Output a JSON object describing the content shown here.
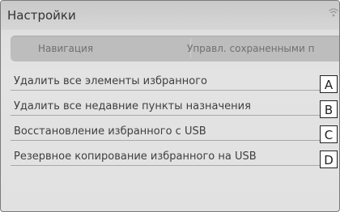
{
  "header": {
    "title": "Настройки",
    "icon": "signal-icon"
  },
  "tabs": [
    {
      "label": "Навигация"
    },
    {
      "label": "Управл. сохраненными п"
    }
  ],
  "menu": [
    {
      "label": "Удалить все элементы избранного",
      "callout": "A"
    },
    {
      "label": "Удалить все недавние пункты назначения",
      "callout": "B"
    },
    {
      "label": "Восстановление избранного с USB",
      "callout": "C"
    },
    {
      "label": "Резервное копирование избранного на USB",
      "callout": "D"
    }
  ]
}
